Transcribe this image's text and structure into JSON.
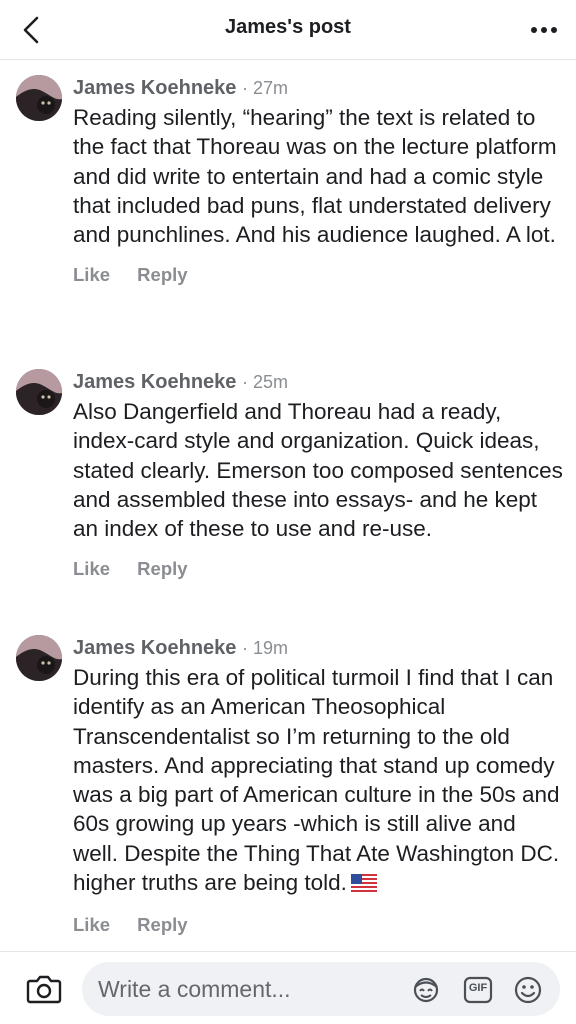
{
  "header": {
    "title": "James's post",
    "back_icon": "chevron-left-icon",
    "more_icon": "more-dots-icon"
  },
  "comments": [
    {
      "author": "James Koehneke",
      "time": "· 27m",
      "text": "Reading silently, “hearing” the text is related to the fact that Thoreau was on the lecture platform and did write to entertain and had a comic style that included bad puns, flat understated delivery and punchlines. And his audience laughed. A lot.",
      "like_label": "Like",
      "reply_label": "Reply"
    },
    {
      "author": "James Koehneke",
      "time": "· 25m",
      "text": "Also Dangerfield and Thoreau had a ready, index-card style and organization. Quick ideas, stated clearly. Emerson too composed sentences and assembled these into essays- and he kept an index of these to use and re-use.",
      "like_label": "Like",
      "reply_label": "Reply"
    },
    {
      "author": "James Koehneke",
      "time": "· 19m",
      "text": "During this era of political turmoil I find that I can identify as an American Theosophical Transcendentalist so I’m returning to the old masters. And appreciating that stand up comedy was a big part of American culture in the 50s and 60s growing up years -which is still alive and well. Despite the Thing That Ate Washington DC. higher truths are being told.",
      "like_label": "Like",
      "reply_label": "Reply"
    }
  ],
  "composer": {
    "placeholder": "Write a comment...",
    "camera_icon": "camera-icon",
    "avatar_icon": "avatar-sticker-icon",
    "gif_label": "GIF",
    "emoji_icon": "smiley-icon"
  },
  "colors": {
    "text": "#1c1e21",
    "secondary": "#65676b",
    "input_bg": "#eff1f4"
  }
}
